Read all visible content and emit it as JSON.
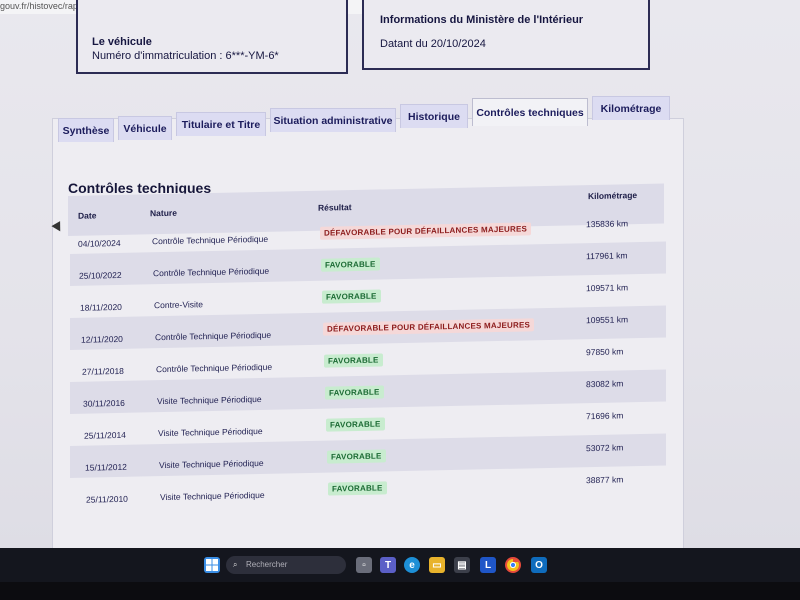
{
  "browser": {
    "url": "gouv.fr/histovec/rapport-vendeur"
  },
  "vehicle_box": {
    "title": "Le véhicule",
    "registration": "Numéro d'immatriculation : 6***-YM-6*"
  },
  "ministry_box": {
    "title": "Informations du Ministère de l'Intérieur",
    "date": "Datant du 20/10/2024"
  },
  "tabs": [
    {
      "label": "Synthèse"
    },
    {
      "label": "Véhicule"
    },
    {
      "label": "Titulaire et Titre"
    },
    {
      "label": "Situation administrative"
    },
    {
      "label": "Historique"
    },
    {
      "label": "Contrôles techniques"
    },
    {
      "label": "Kilométrage"
    }
  ],
  "section": {
    "title": "Contrôles techniques",
    "columns": {
      "date": "Date",
      "nature": "Nature",
      "result": "Résultat",
      "mileage": "Kilométrage"
    },
    "rows": [
      {
        "date": "04/10/2024",
        "nature": "Contrôle Technique Périodique",
        "result": "DÉFAVORABLE POUR DÉFAILLANCES MAJEURES",
        "status": "defav",
        "mileage": "135836 km"
      },
      {
        "date": "25/10/2022",
        "nature": "Contrôle Technique Périodique",
        "result": "FAVORABLE",
        "status": "fav",
        "mileage": "117961 km"
      },
      {
        "date": "18/11/2020",
        "nature": "Contre-Visite",
        "result": "FAVORABLE",
        "status": "fav",
        "mileage": "109571 km"
      },
      {
        "date": "12/11/2020",
        "nature": "Contrôle Technique Périodique",
        "result": "DÉFAVORABLE POUR DÉFAILLANCES MAJEURES",
        "status": "defav",
        "mileage": "109551 km"
      },
      {
        "date": "27/11/2018",
        "nature": "Contrôle Technique Périodique",
        "result": "FAVORABLE",
        "status": "fav",
        "mileage": "97850 km"
      },
      {
        "date": "30/11/2016",
        "nature": "Visite Technique Périodique",
        "result": "FAVORABLE",
        "status": "fav",
        "mileage": "83082 km"
      },
      {
        "date": "25/11/2014",
        "nature": "Visite Technique Périodique",
        "result": "FAVORABLE",
        "status": "fav",
        "mileage": "71696 km"
      },
      {
        "date": "15/11/2012",
        "nature": "Visite Technique Périodique",
        "result": "FAVORABLE",
        "status": "fav",
        "mileage": "53072 km"
      },
      {
        "date": "25/11/2010",
        "nature": "Visite Technique Périodique",
        "result": "FAVORABLE",
        "status": "fav",
        "mileage": "38877 km"
      }
    ]
  },
  "taskbar": {
    "search_placeholder": "Rechercher",
    "icons": [
      "windows-start-icon",
      "search-icon",
      "task-view-icon",
      "teams-icon",
      "edge-icon",
      "file-explorer-icon",
      "store-icon",
      "l-app-icon",
      "chrome-icon",
      "outlook-icon"
    ]
  },
  "colors": {
    "favorable_bg": "#c8eccf",
    "favorable_text": "#1c6b34",
    "defavorable_bg": "#f5d8d8",
    "defavorable_text": "#8c1c1c",
    "active_tab_bg": "#f2f2f6",
    "tab_bg": "#dcdcf2"
  }
}
